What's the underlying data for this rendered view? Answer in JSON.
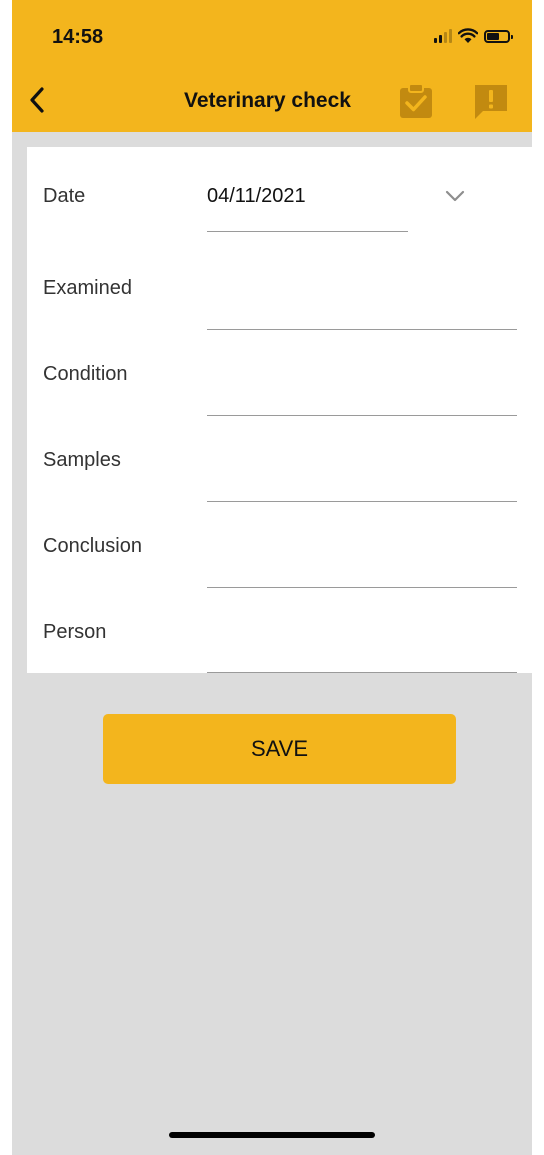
{
  "status_bar": {
    "time": "14:58"
  },
  "header": {
    "title": "Veterinary check"
  },
  "form": {
    "date": {
      "label": "Date",
      "value": "04/11/2021"
    },
    "fields": [
      {
        "label": "Examined",
        "value": ""
      },
      {
        "label": "Condition",
        "value": ""
      },
      {
        "label": "Samples",
        "value": ""
      },
      {
        "label": "Conclusion",
        "value": ""
      },
      {
        "label": "Person",
        "value": ""
      }
    ]
  },
  "actions": {
    "save_label": "SAVE"
  },
  "colors": {
    "accent": "#f3b51d",
    "icon_dark": "#c28a10",
    "background": "#dcdcdc",
    "card": "#ffffff",
    "text": "#111111"
  }
}
